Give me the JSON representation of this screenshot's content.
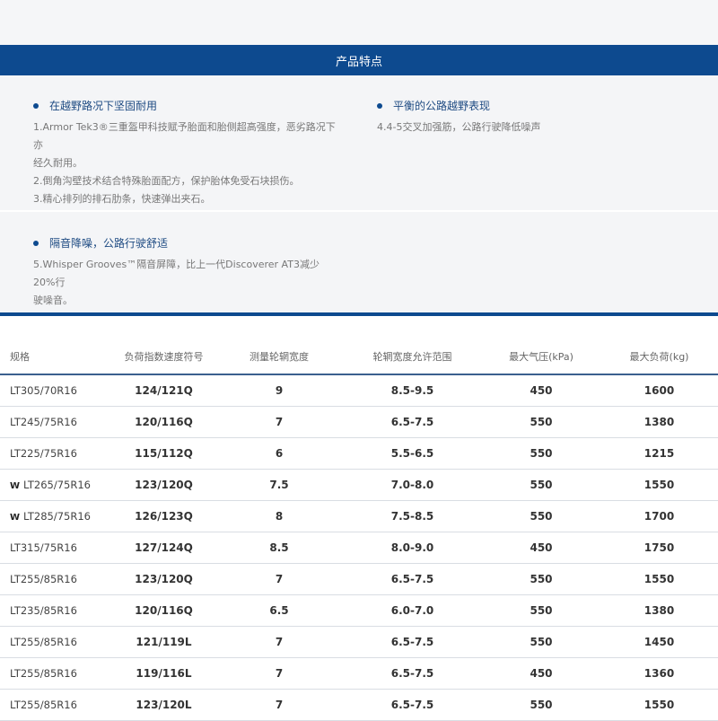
{
  "banner": {
    "title": "产品特点"
  },
  "features": [
    {
      "title": "在越野路况下坚固耐用",
      "lines": [
        "1.Armor Tek3®三重盔甲科技赋予胎面和胎侧超高强度，恶劣路况下亦",
        "经久耐用。",
        "2.倒角沟壁技术结合特殊胎面配方，保护胎体免受石块损伤。",
        "3.精心排列的排石肋条，快速弹出夹石。"
      ]
    },
    {
      "title": "平衡的公路越野表现",
      "lines": [
        "4.4-5交叉加强筋，公路行驶降低噪声"
      ]
    },
    {
      "title": "隔音降噪，公路行驶舒适",
      "lines": [
        "5.Whisper Grooves™隔音屏障，比上一代Discoverer AT3减少20%行",
        "驶噪音。"
      ]
    }
  ],
  "table": {
    "headers": [
      "规格",
      "负荷指数速度符号",
      "测量轮辋宽度",
      "轮辋宽度允许范围",
      "最大气压(kPa)",
      "最大负荷(kg)"
    ],
    "rows": [
      {
        "spec": "LT305/70R16",
        "icon": "",
        "load": "124/121Q",
        "rim": "9",
        "range": "8.5-9.5",
        "pressure": "450",
        "max_load": "1600"
      },
      {
        "spec": "LT245/75R16",
        "icon": "",
        "load": "120/116Q",
        "rim": "7",
        "range": "6.5-7.5",
        "pressure": "550",
        "max_load": "1380"
      },
      {
        "spec": "LT225/75R16",
        "icon": "",
        "load": "115/112Q",
        "rim": "6",
        "range": "5.5-6.5",
        "pressure": "550",
        "max_load": "1215"
      },
      {
        "spec": "LT265/75R16",
        "icon": "W",
        "load": "123/120Q",
        "rim": "7.5",
        "range": "7.0-8.0",
        "pressure": "550",
        "max_load": "1550"
      },
      {
        "spec": "LT285/75R16",
        "icon": "W",
        "load": "126/123Q",
        "rim": "8",
        "range": "7.5-8.5",
        "pressure": "550",
        "max_load": "1700"
      },
      {
        "spec": "LT315/75R16",
        "icon": "",
        "load": "127/124Q",
        "rim": "8.5",
        "range": "8.0-9.0",
        "pressure": "450",
        "max_load": "1750"
      },
      {
        "spec": "LT255/85R16",
        "icon": "",
        "load": "123/120Q",
        "rim": "7",
        "range": "6.5-7.5",
        "pressure": "550",
        "max_load": "1550"
      },
      {
        "spec": "LT235/85R16",
        "icon": "",
        "load": "120/116Q",
        "rim": "6.5",
        "range": "6.0-7.0",
        "pressure": "550",
        "max_load": "1380"
      },
      {
        "spec": "LT255/85R16",
        "icon": "",
        "load": "121/119L",
        "rim": "7",
        "range": "6.5-7.5",
        "pressure": "550",
        "max_load": "1450"
      },
      {
        "spec": "LT255/85R16",
        "icon": "",
        "load": "119/116L",
        "rim": "7",
        "range": "6.5-7.5",
        "pressure": "450",
        "max_load": "1360"
      },
      {
        "spec": "LT255/85R16",
        "icon": "",
        "load": "123/120L",
        "rim": "7",
        "range": "6.5-7.5",
        "pressure": "550",
        "max_load": "1550"
      }
    ]
  }
}
